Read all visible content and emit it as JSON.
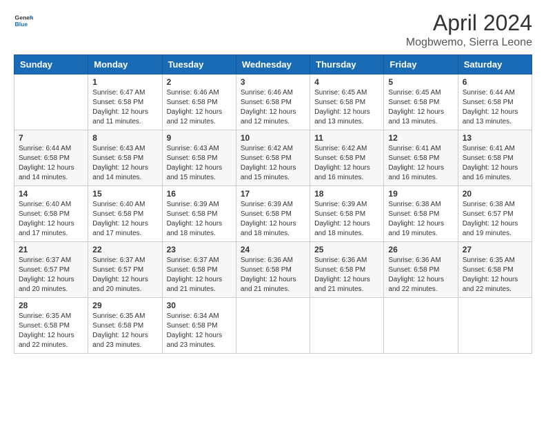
{
  "header": {
    "logo_line1": "General",
    "logo_line2": "Blue",
    "title": "April 2024",
    "subtitle": "Mogbwemo, Sierra Leone"
  },
  "days_of_week": [
    "Sunday",
    "Monday",
    "Tuesday",
    "Wednesday",
    "Thursday",
    "Friday",
    "Saturday"
  ],
  "weeks": [
    [
      {
        "day": "",
        "info": ""
      },
      {
        "day": "1",
        "info": "Sunrise: 6:47 AM\nSunset: 6:58 PM\nDaylight: 12 hours\nand 11 minutes."
      },
      {
        "day": "2",
        "info": "Sunrise: 6:46 AM\nSunset: 6:58 PM\nDaylight: 12 hours\nand 12 minutes."
      },
      {
        "day": "3",
        "info": "Sunrise: 6:46 AM\nSunset: 6:58 PM\nDaylight: 12 hours\nand 12 minutes."
      },
      {
        "day": "4",
        "info": "Sunrise: 6:45 AM\nSunset: 6:58 PM\nDaylight: 12 hours\nand 13 minutes."
      },
      {
        "day": "5",
        "info": "Sunrise: 6:45 AM\nSunset: 6:58 PM\nDaylight: 12 hours\nand 13 minutes."
      },
      {
        "day": "6",
        "info": "Sunrise: 6:44 AM\nSunset: 6:58 PM\nDaylight: 12 hours\nand 13 minutes."
      }
    ],
    [
      {
        "day": "7",
        "info": "Sunrise: 6:44 AM\nSunset: 6:58 PM\nDaylight: 12 hours\nand 14 minutes."
      },
      {
        "day": "8",
        "info": "Sunrise: 6:43 AM\nSunset: 6:58 PM\nDaylight: 12 hours\nand 14 minutes."
      },
      {
        "day": "9",
        "info": "Sunrise: 6:43 AM\nSunset: 6:58 PM\nDaylight: 12 hours\nand 15 minutes."
      },
      {
        "day": "10",
        "info": "Sunrise: 6:42 AM\nSunset: 6:58 PM\nDaylight: 12 hours\nand 15 minutes."
      },
      {
        "day": "11",
        "info": "Sunrise: 6:42 AM\nSunset: 6:58 PM\nDaylight: 12 hours\nand 16 minutes."
      },
      {
        "day": "12",
        "info": "Sunrise: 6:41 AM\nSunset: 6:58 PM\nDaylight: 12 hours\nand 16 minutes."
      },
      {
        "day": "13",
        "info": "Sunrise: 6:41 AM\nSunset: 6:58 PM\nDaylight: 12 hours\nand 16 minutes."
      }
    ],
    [
      {
        "day": "14",
        "info": "Sunrise: 6:40 AM\nSunset: 6:58 PM\nDaylight: 12 hours\nand 17 minutes."
      },
      {
        "day": "15",
        "info": "Sunrise: 6:40 AM\nSunset: 6:58 PM\nDaylight: 12 hours\nand 17 minutes."
      },
      {
        "day": "16",
        "info": "Sunrise: 6:39 AM\nSunset: 6:58 PM\nDaylight: 12 hours\nand 18 minutes."
      },
      {
        "day": "17",
        "info": "Sunrise: 6:39 AM\nSunset: 6:58 PM\nDaylight: 12 hours\nand 18 minutes."
      },
      {
        "day": "18",
        "info": "Sunrise: 6:39 AM\nSunset: 6:58 PM\nDaylight: 12 hours\nand 18 minutes."
      },
      {
        "day": "19",
        "info": "Sunrise: 6:38 AM\nSunset: 6:58 PM\nDaylight: 12 hours\nand 19 minutes."
      },
      {
        "day": "20",
        "info": "Sunrise: 6:38 AM\nSunset: 6:57 PM\nDaylight: 12 hours\nand 19 minutes."
      }
    ],
    [
      {
        "day": "21",
        "info": "Sunrise: 6:37 AM\nSunset: 6:57 PM\nDaylight: 12 hours\nand 20 minutes."
      },
      {
        "day": "22",
        "info": "Sunrise: 6:37 AM\nSunset: 6:57 PM\nDaylight: 12 hours\nand 20 minutes."
      },
      {
        "day": "23",
        "info": "Sunrise: 6:37 AM\nSunset: 6:58 PM\nDaylight: 12 hours\nand 21 minutes."
      },
      {
        "day": "24",
        "info": "Sunrise: 6:36 AM\nSunset: 6:58 PM\nDaylight: 12 hours\nand 21 minutes."
      },
      {
        "day": "25",
        "info": "Sunrise: 6:36 AM\nSunset: 6:58 PM\nDaylight: 12 hours\nand 21 minutes."
      },
      {
        "day": "26",
        "info": "Sunrise: 6:36 AM\nSunset: 6:58 PM\nDaylight: 12 hours\nand 22 minutes."
      },
      {
        "day": "27",
        "info": "Sunrise: 6:35 AM\nSunset: 6:58 PM\nDaylight: 12 hours\nand 22 minutes."
      }
    ],
    [
      {
        "day": "28",
        "info": "Sunrise: 6:35 AM\nSunset: 6:58 PM\nDaylight: 12 hours\nand 22 minutes."
      },
      {
        "day": "29",
        "info": "Sunrise: 6:35 AM\nSunset: 6:58 PM\nDaylight: 12 hours\nand 23 minutes."
      },
      {
        "day": "30",
        "info": "Sunrise: 6:34 AM\nSunset: 6:58 PM\nDaylight: 12 hours\nand 23 minutes."
      },
      {
        "day": "",
        "info": ""
      },
      {
        "day": "",
        "info": ""
      },
      {
        "day": "",
        "info": ""
      },
      {
        "day": "",
        "info": ""
      }
    ]
  ]
}
